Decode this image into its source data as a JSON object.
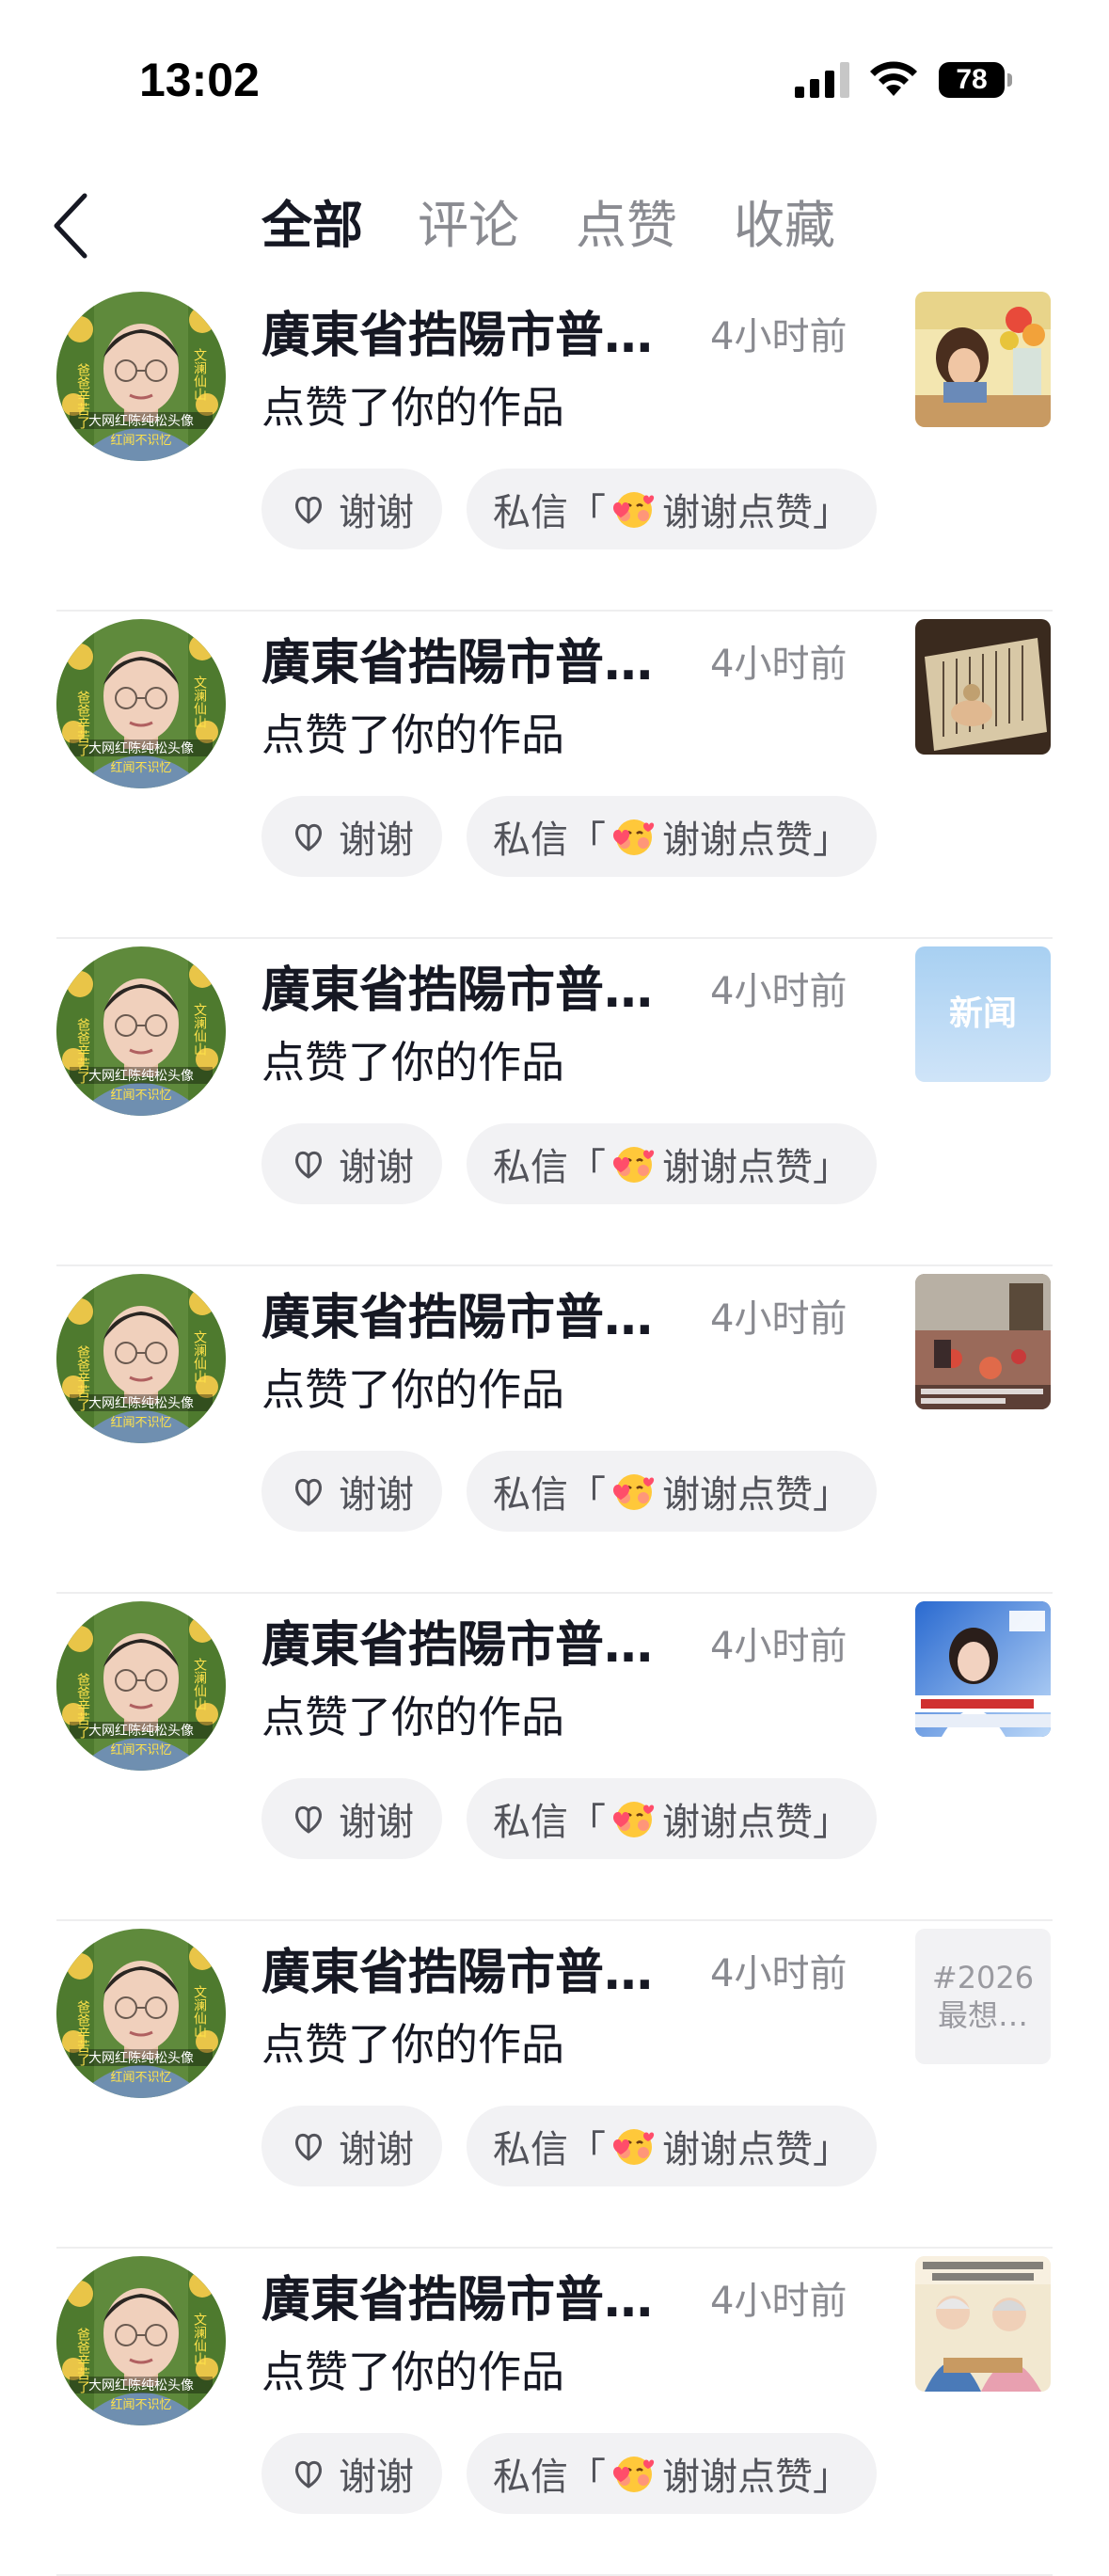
{
  "status_bar": {
    "time": "13:02",
    "battery": "78"
  },
  "nav": {
    "back_icon": "chevron-left-icon",
    "tabs": [
      {
        "label": "全部",
        "active": true
      },
      {
        "label": "评论",
        "active": false
      },
      {
        "label": "点赞",
        "active": false
      },
      {
        "label": "收藏",
        "active": false
      }
    ]
  },
  "notifications": [
    {
      "name": "廣東省捁陽市普…",
      "time": "4小时前",
      "action": "点赞了你的作品",
      "thanks": "谢谢",
      "dm_prefix": "私信「",
      "dm_text": "谢谢点赞」",
      "thumb": {
        "kind": "painting-girl-flowers"
      }
    },
    {
      "name": "廣東省捁陽市普…",
      "time": "4小时前",
      "action": "点赞了你的作品",
      "thanks": "谢谢",
      "dm_prefix": "私信「",
      "dm_text": "谢谢点赞」",
      "thumb": {
        "kind": "old-book"
      }
    },
    {
      "name": "廣東省捁陽市普…",
      "time": "4小时前",
      "action": "点赞了你的作品",
      "thanks": "谢谢",
      "dm_prefix": "私信「",
      "dm_text": "谢谢点赞」",
      "thumb": {
        "kind": "news-tile",
        "text": "新闻"
      }
    },
    {
      "name": "廣東省捁陽市普…",
      "time": "4小时前",
      "action": "点赞了你的作品",
      "thanks": "谢谢",
      "dm_prefix": "私信「",
      "dm_text": "谢谢点赞」",
      "thumb": {
        "kind": "room-photo"
      }
    },
    {
      "name": "廣東省捁陽市普…",
      "time": "4小时前",
      "action": "点赞了你的作品",
      "thanks": "谢谢",
      "dm_prefix": "私信「",
      "dm_text": "谢谢点赞」",
      "thumb": {
        "kind": "news-anchor"
      }
    },
    {
      "name": "廣東省捁陽市普…",
      "time": "4小时前",
      "action": "点赞了你的作品",
      "thanks": "谢谢",
      "dm_prefix": "私信「",
      "dm_text": "谢谢点赞」",
      "thumb": {
        "kind": "text-tile",
        "text": "#2026\n最想…"
      }
    },
    {
      "name": "廣東省捁陽市普…",
      "time": "4小时前",
      "action": "点赞了你的作品",
      "thanks": "谢谢",
      "dm_prefix": "私信「",
      "dm_text": "谢谢点赞」",
      "thumb": {
        "kind": "elderly-couple"
      }
    }
  ],
  "colors": {
    "primary_text": "#161823",
    "secondary_text": "#8a8b91",
    "chip_bg": "#f2f2f4",
    "divider": "#eeeeef"
  }
}
